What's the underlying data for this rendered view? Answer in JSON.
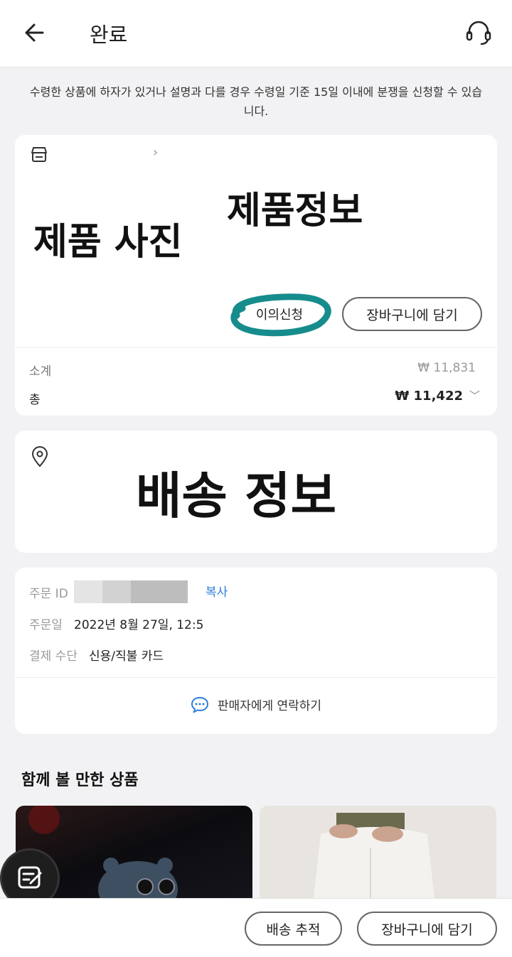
{
  "header": {
    "title": "완료",
    "back_icon": "arrow-left-icon",
    "support_icon": "headset-icon"
  },
  "notice": "수령한 상품에 하자가 있거나 설명과 다를 경우 수령일 기준 15일 이내에 분쟁을 신청할 수 있습니다.",
  "product_card": {
    "store_icon": "store-icon",
    "product_info_overlay": "제품정보",
    "product_photo_overlay": "제품 사진",
    "dispute_button": "이의신청",
    "add_to_cart_button": "장바구니에 담기",
    "subtotal_label": "소계",
    "subtotal_value": "₩ 11,831",
    "total_label": "총",
    "total_value": "₩ 11,422",
    "highlight_color": "#168c8c"
  },
  "shipping_card": {
    "pin_icon": "location-pin-icon",
    "overlay": "배송 정보"
  },
  "order_card": {
    "order_id_label": "주문 ID",
    "copy_label": "복사",
    "order_date_label": "주문일",
    "order_date_value": "2022년 8월 27일, 12:5",
    "payment_label": "결제 수단",
    "payment_value": "신용/직불 카드",
    "contact_label": "판매자에게 연락하기",
    "link_color": "#2f7fd8"
  },
  "recommend": {
    "title": "함께 볼 만한 상품"
  },
  "bottom_bar": {
    "track_button": "배송 추적",
    "cart_button": "장바구니에 담기"
  }
}
